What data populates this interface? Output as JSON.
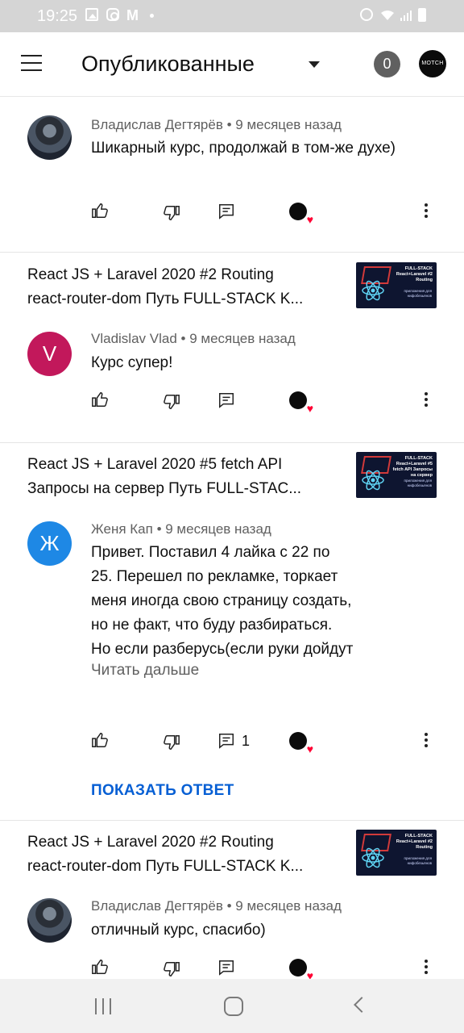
{
  "status_bar": {
    "time": "19:25"
  },
  "header": {
    "title": "Опубликованные",
    "count": "0",
    "channel_avatar_text": "MOTCH"
  },
  "cards": [
    {
      "author": "Владислав Дегтярёв",
      "age": "9 месяцев назад",
      "text": "Шикарный курс, продолжай в том-же духе)",
      "avatar_type": "photo"
    },
    {
      "video_title_line1": "React JS + Laravel 2020 #2 Routing",
      "video_title_line2": "react-router-dom Путь FULL-STACK K...",
      "thumb_title": "FULL-STACK React+Laravel #2 Routing",
      "thumb_sub": "приложения для нифобезьянов",
      "author": "Vladislav Vlad",
      "age": "9 месяцев назад",
      "text": "Курс супер!",
      "avatar_letter": "V",
      "avatar_color": "#c2185b"
    },
    {
      "video_title_line1": "React JS + Laravel 2020 #5 fetch API",
      "video_title_line2": "Запросы на сервер Путь FULL-STAC...",
      "thumb_title": "FULL-STACK React+Laravel #5 fetch API Запросы на сервер",
      "thumb_sub": "приложения для нифобезьянов",
      "author": "Женя Кап",
      "age": "9 месяцев назад",
      "text_lines": [
        "Привет. Поставил 4 лайка с 22 по",
        "25. Перешел по рекламке, торкает",
        "меня иногда свою страницу создать,",
        "но не факт, что буду разбираться.",
        "Но если разберусь(если руки дойдут"
      ],
      "read_more": "Читать дальше",
      "reply_count": "1",
      "show_reply": "ПОКАЗАТЬ ОТВЕТ",
      "avatar_letter": "Ж",
      "avatar_color": "#1e88e5"
    },
    {
      "video_title_line1": "React JS + Laravel 2020 #2 Routing",
      "video_title_line2": "react-router-dom Путь FULL-STACK K...",
      "thumb_title": "FULL-STACK React+Laravel #2 Routing",
      "thumb_sub": "приложения для нифобезьянов",
      "author": "Владислав Дегтярёв",
      "age": "9 месяцев назад",
      "text": "отличный курс, спасибо)",
      "avatar_type": "photo"
    }
  ],
  "meta_separator": "•",
  "colors": {
    "link": "#065fd4",
    "heart": "#ff0033",
    "muted": "#606060"
  }
}
